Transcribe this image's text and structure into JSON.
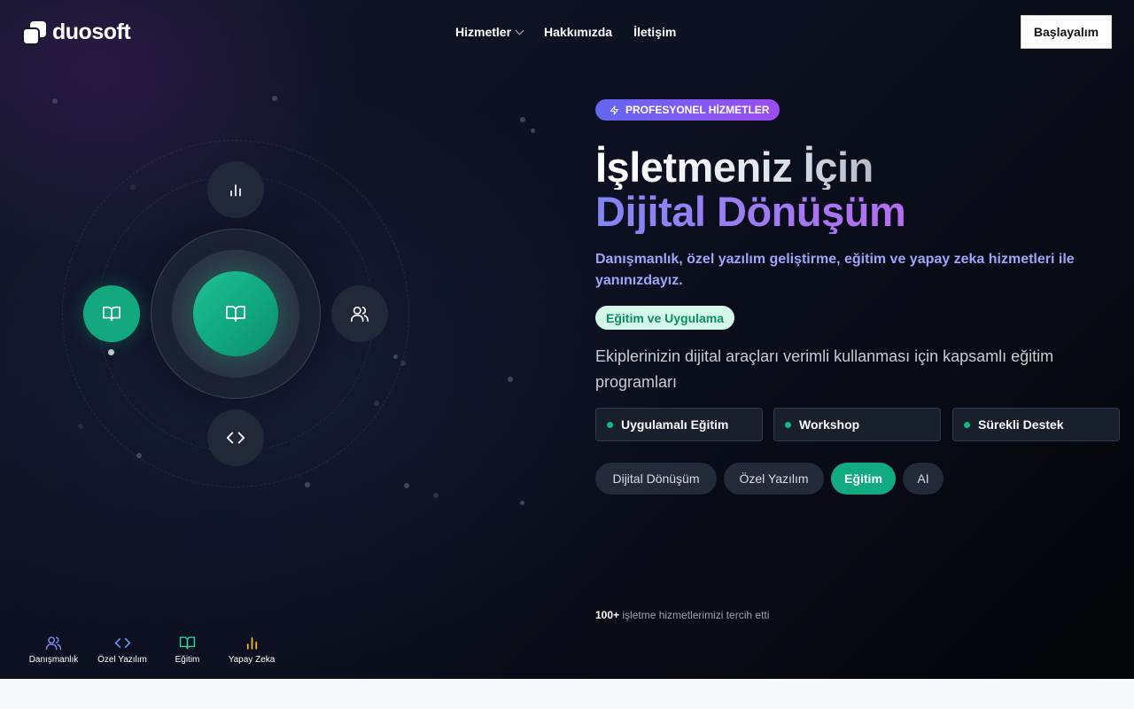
{
  "brand": {
    "name": "duosoft"
  },
  "nav": {
    "items": [
      {
        "label": "Hizmetler",
        "has_dropdown": true
      },
      {
        "label": "Hakkımızda"
      },
      {
        "label": "İletişim"
      }
    ],
    "cta_label": "Başlayalım"
  },
  "hero": {
    "badge": "PROFESYONEL HİZMETLER",
    "title_line1": "İşletmeniz İçin",
    "title_line2": "Dijital Dönüşüm",
    "subtitle": "Danışmanlık, özel yazılım geliştirme, eğitim ve yapay zeka hizmetleri ile yanınızdayız.",
    "active_service": {
      "tag": "Eğitim ve Uygulama",
      "description": "Ekiplerinizin dijital araçları verimli kullanması için kapsamlı eğitim programları",
      "features": [
        "Uygulamalı Eğitim",
        "Workshop",
        "Sürekli Destek"
      ]
    },
    "tabs": [
      {
        "label": "Dijital Dönüşüm",
        "active": false
      },
      {
        "label": "Özel Yazılım",
        "active": false
      },
      {
        "label": "Eğitim",
        "active": true
      },
      {
        "label": "AI",
        "active": false
      }
    ],
    "trust": {
      "count": "100+",
      "text": "işletme hizmetlerimizi tercih etti"
    }
  },
  "orbit": {
    "center_icon": "book-icon",
    "satellites": [
      "bar-chart-icon",
      "book-icon",
      "users-icon",
      "code-icon"
    ]
  },
  "bottom_nav": [
    {
      "label": "Danışmanlık",
      "icon": "users-icon",
      "color": "#818cf8"
    },
    {
      "label": "Özel Yazılım",
      "icon": "code-icon",
      "color": "#60a5fa"
    },
    {
      "label": "Eğitim",
      "icon": "book-icon",
      "color": "#34d399"
    },
    {
      "label": "Yapay Zeka",
      "icon": "bar-chart-icon",
      "color": "#fbbf24"
    }
  ],
  "colors": {
    "accent_green": "#10b981",
    "accent_purple": "#8b5cf6",
    "accent_indigo": "#6366f1"
  }
}
